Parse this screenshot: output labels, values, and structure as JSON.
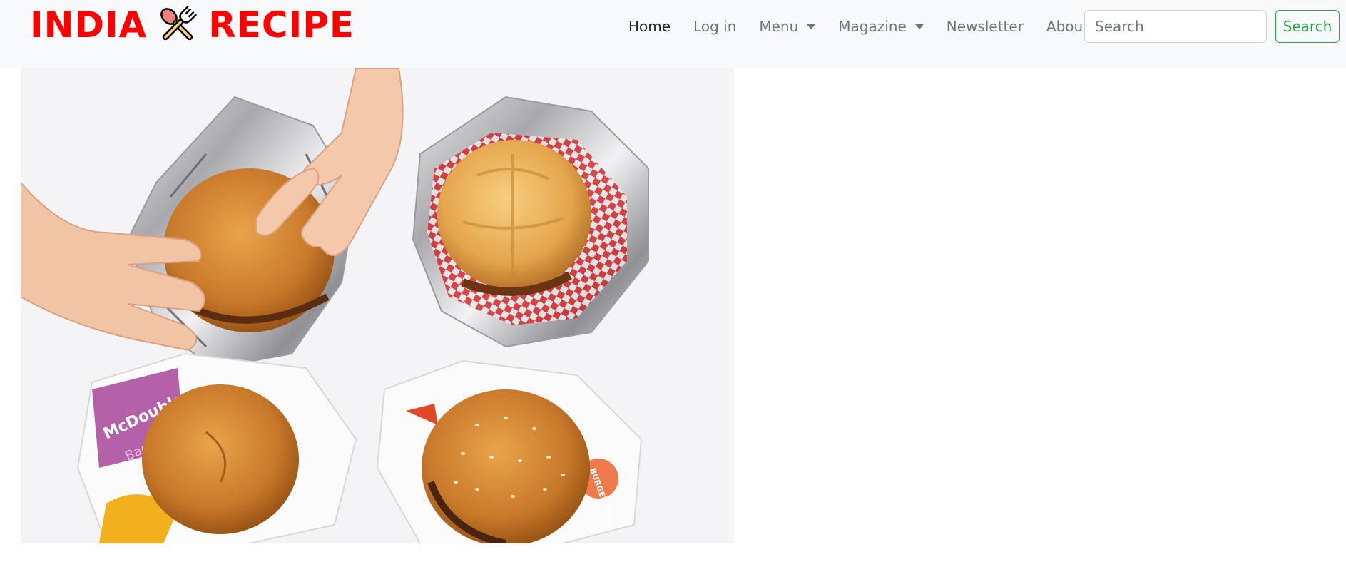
{
  "brand": {
    "part1": "INDIA",
    "part2": "RECIPE",
    "logo_icon": "spoon-fork-icon",
    "color": "#ff0000"
  },
  "nav": {
    "items": [
      {
        "label": "Home",
        "active": true
      },
      {
        "label": "Log in"
      },
      {
        "label": "Menu",
        "dropdown": true
      },
      {
        "label": "Magazine",
        "dropdown": true
      },
      {
        "label": "Newsletter"
      },
      {
        "label": "About Us"
      }
    ]
  },
  "search": {
    "placeholder": "Search",
    "button_label": "Search"
  },
  "hero": {
    "description": "Overhead photo of four fast-food burgers on wrappers",
    "wrapper_texts": [
      "McDouble",
      "Bacon",
      "BURGER KING"
    ]
  },
  "colors": {
    "navbar_bg": "#f8f9fa",
    "nav_text": "#6c757d",
    "nav_active": "#212529",
    "search_accent": "#28a745"
  }
}
